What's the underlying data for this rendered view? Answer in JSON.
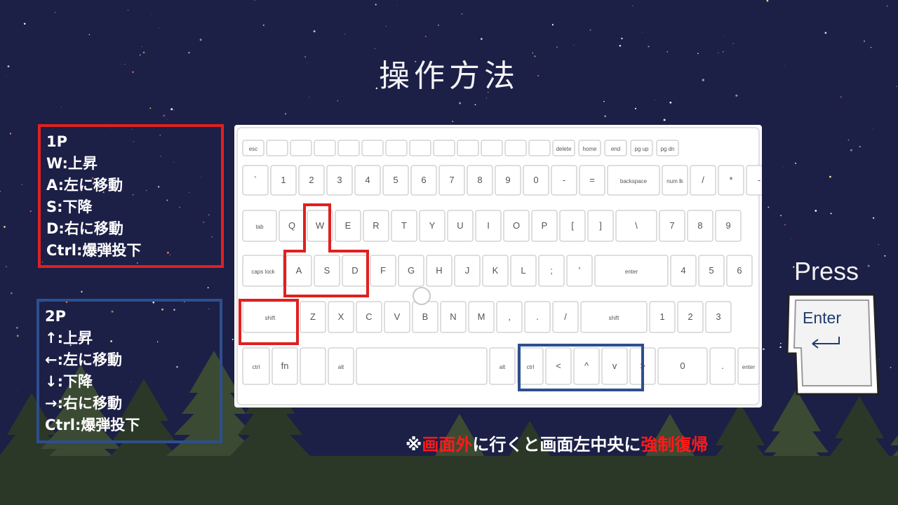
{
  "title": "操作方法",
  "player1": {
    "heading": "1P",
    "lines": [
      "W:上昇",
      "A:左に移動",
      "S:下降",
      "D:右に移動",
      "Ctrl:爆弾投下"
    ]
  },
  "player2": {
    "heading": "2P",
    "lines": [
      "↑:上昇",
      "←:左に移動",
      "↓:下降",
      "→:右に移動",
      "Ctrl:爆弾投下"
    ]
  },
  "press_label": "Press",
  "enter_key_label": "Enter",
  "note": {
    "prefix": "※",
    "red1": "画面外",
    "mid": "に行くと画面左中央に",
    "red2": "強制復帰"
  },
  "keyboard": {
    "row1": [
      "esc",
      "",
      "",
      "",
      "",
      "",
      "",
      "",
      "",
      "",
      "",
      "",
      "",
      "delete",
      "home",
      "end",
      "pg up",
      "pg dn"
    ],
    "row2": [
      "`",
      "1",
      "2",
      "3",
      "4",
      "5",
      "6",
      "7",
      "8",
      "9",
      "0",
      "-",
      "=",
      "backspace",
      "num lk",
      "/",
      "*",
      "-"
    ],
    "row3": [
      "tab",
      "Q",
      "W",
      "E",
      "R",
      "T",
      "Y",
      "U",
      "I",
      "O",
      "P",
      "[",
      "]",
      "\\",
      "7",
      "8",
      "9"
    ],
    "row4": [
      "caps lock",
      "A",
      "S",
      "D",
      "F",
      "G",
      "H",
      "J",
      "K",
      "L",
      ";",
      "'",
      "enter",
      "4",
      "5",
      "6"
    ],
    "row5": [
      "shift",
      "Z",
      "X",
      "C",
      "V",
      "B",
      "N",
      "M",
      ",",
      ".",
      "/",
      "shift",
      "1",
      "2",
      "3"
    ],
    "row6": [
      "ctrl",
      "fn",
      "",
      "alt",
      "",
      "alt",
      "ctrl",
      "<",
      "^",
      "v",
      ">",
      "0",
      ".",
      "enter"
    ],
    "colors": {
      "p1_highlight": "#e02020",
      "p2_highlight": "#2d4f8e",
      "key_border": "#c9c9c9",
      "key_text": "#555555"
    }
  },
  "colors": {
    "sky": "#1c1f46",
    "tree": "#3b4a33",
    "tree_dark": "#2c3827",
    "accent_red": "#ff1a1a"
  }
}
